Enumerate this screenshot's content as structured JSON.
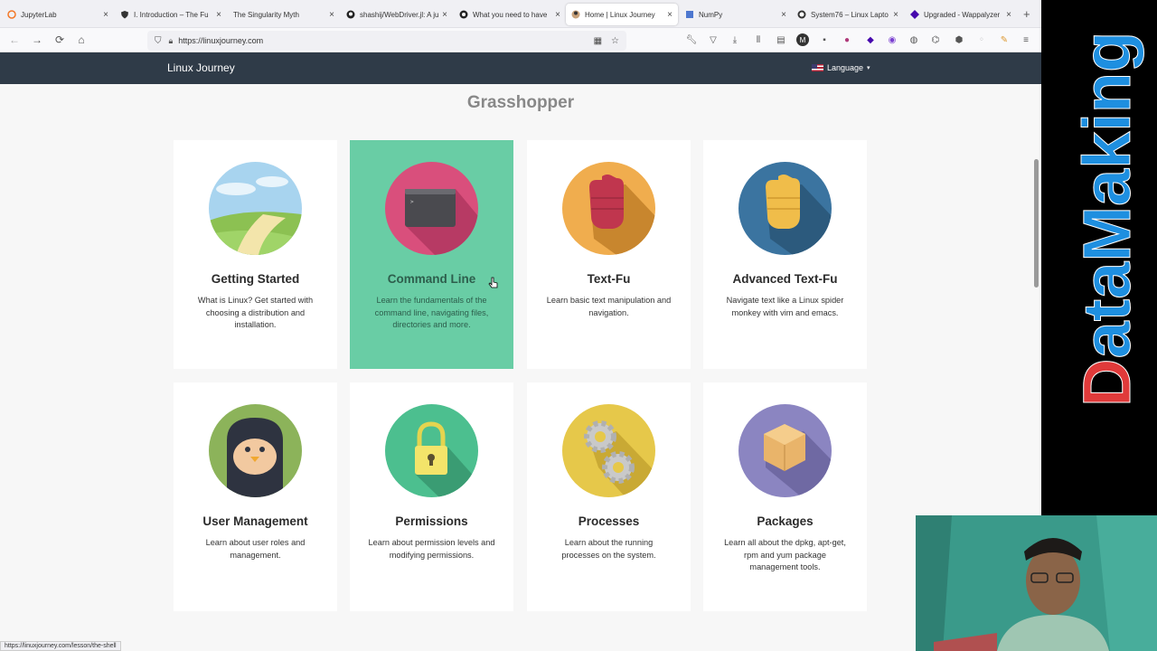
{
  "browser": {
    "tabs": [
      {
        "label": "JupyterLab",
        "icon": "jupyter-icon",
        "active": false
      },
      {
        "label": "I. Introduction – The Fu",
        "icon": "shield-icon",
        "active": false
      },
      {
        "label": "The Singularity Myth",
        "icon": "",
        "active": false
      },
      {
        "label": "shashij/WebDriver.jl: A ju",
        "icon": "github-icon",
        "active": false
      },
      {
        "label": "What you need to have",
        "icon": "globe-icon",
        "active": false
      },
      {
        "label": "Home | Linux Journey",
        "icon": "linux-journey-icon",
        "active": true
      },
      {
        "label": "NumPy",
        "icon": "numpy-icon",
        "active": false
      },
      {
        "label": "System76 – Linux Lapto",
        "icon": "system76-icon",
        "active": false
      },
      {
        "label": "Upgraded - Wappalyzer",
        "icon": "wappalyzer-icon",
        "active": false
      }
    ],
    "url": "https://linuxjourney.com",
    "status_url": "https://linuxjourney.com/lesson/the-shell"
  },
  "site": {
    "brand": "Linux Journey",
    "language_label": "Language",
    "section_title": "Grasshopper",
    "cards": [
      {
        "title": "Getting Started",
        "desc": "What is Linux? Get started with choosing a distribution and installation.",
        "icon": "landscape-icon",
        "highlight": false
      },
      {
        "title": "Command Line",
        "desc": "Learn the fundamentals of the command line, navigating files, directories and more.",
        "icon": "terminal-icon",
        "highlight": true
      },
      {
        "title": "Text-Fu",
        "desc": "Learn basic text manipulation and navigation.",
        "icon": "fist-icon",
        "highlight": false
      },
      {
        "title": "Advanced Text-Fu",
        "desc": "Navigate text like a Linux spider monkey with vim and emacs.",
        "icon": "fist-icon",
        "highlight": false
      },
      {
        "title": "User Management",
        "desc": "Learn about user roles and management.",
        "icon": "penguin-icon",
        "highlight": false
      },
      {
        "title": "Permissions",
        "desc": "Learn about permission levels and modifying permissions.",
        "icon": "padlock-icon",
        "highlight": false
      },
      {
        "title": "Processes",
        "desc": "Learn about the running processes on the system.",
        "icon": "gears-icon",
        "highlight": false
      },
      {
        "title": "Packages",
        "desc": "Learn all about the dpkg, apt-get, rpm and yum package management tools.",
        "icon": "package-box-icon",
        "highlight": false
      }
    ]
  },
  "overlay": {
    "channel_name": "DataMaking"
  },
  "colors": {
    "header_bg": "#2f3b48",
    "highlight_card": "#69cda5",
    "dm_blue": "#1e8fe0",
    "dm_red": "#e03a3a"
  }
}
